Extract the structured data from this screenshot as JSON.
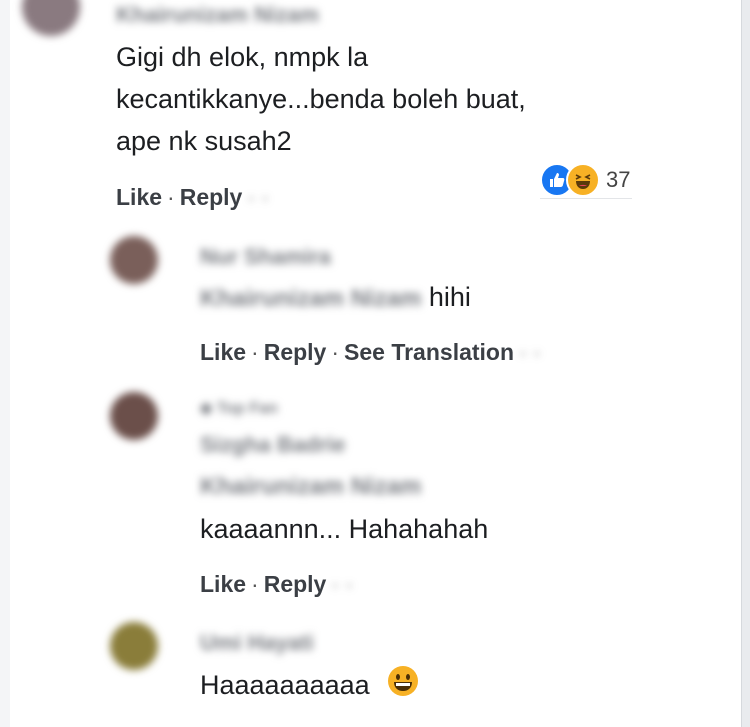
{
  "comments": [
    {
      "author": "Khairunizam Nizam",
      "text_lines": [
        "Gigi dh elok, nmpk la",
        "kecantikkanye...benda boleh buat,",
        "ape nk susah2"
      ],
      "actions": {
        "like": "Like",
        "reply": "Reply"
      },
      "reaction_count": "37"
    },
    {
      "author": "Nur Shamira",
      "mention": "Khairunizam Nizam",
      "text": "hihi",
      "actions": {
        "like": "Like",
        "reply": "Reply",
        "translate": "See Translation"
      }
    },
    {
      "badge": "Top Fan",
      "author": "Sizgha Badrie",
      "mention": "Khairunizam Nizam",
      "text": "kaaaannn... Hahahahah",
      "actions": {
        "like": "Like",
        "reply": "Reply"
      }
    },
    {
      "author": "Umi Hayati",
      "text": "Haaaaaaaaaa",
      "emoji": "grinning-face-icon"
    }
  ],
  "icons": {
    "like_reaction": "thumbs-up-icon",
    "haha_reaction": "laughing-face-icon"
  },
  "colors": {
    "like_blue": "#1877f2",
    "haha_yellow": "#f7b125"
  }
}
